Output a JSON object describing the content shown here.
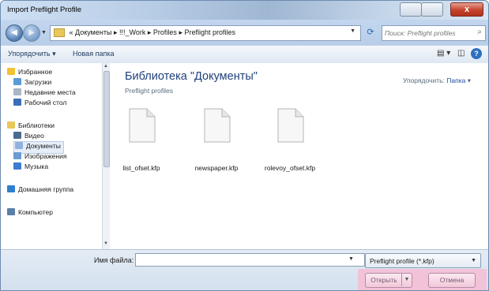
{
  "window": {
    "title": "Import Preflight Profile",
    "close_glyph": "x"
  },
  "address": {
    "prefix": "«",
    "crumbs": [
      "Документы",
      "!!!_Work",
      "Profiles",
      "Preflight profiles"
    ],
    "separator": "▸",
    "search_placeholder": "Поиск: Preflight profiles"
  },
  "toolbar": {
    "organize": "Упорядочить",
    "new_folder": "Новая папка"
  },
  "sidebar": {
    "items": [
      {
        "label": "Избранное",
        "icon": "star-icon",
        "color": "#f1c232"
      },
      {
        "label": "Загрузки",
        "icon": "downloads-icon",
        "color": "#5b9bd5"
      },
      {
        "label": "Недавние места",
        "icon": "recent-places-icon",
        "color": "#a9b7c6"
      },
      {
        "label": "Рабочий стол",
        "icon": "desktop-icon",
        "color": "#3a6fb7"
      },
      {
        "label": "Библиотеки",
        "icon": "libraries-icon",
        "color": "#e9c85a"
      },
      {
        "label": "Видео",
        "icon": "video-icon",
        "color": "#4a6a8f"
      },
      {
        "label": "Документы",
        "icon": "documents-icon",
        "color": "#8fb3dc"
      },
      {
        "label": "Изображения",
        "icon": "pictures-icon",
        "color": "#6b9bd2"
      },
      {
        "label": "Музыка",
        "icon": "music-icon",
        "color": "#3e7bd1"
      },
      {
        "label": "Домашняя группа",
        "icon": "homegroup-icon",
        "color": "#2f7fcf"
      },
      {
        "label": "Компьютер",
        "icon": "computer-icon",
        "color": "#5a7fa8"
      }
    ]
  },
  "library": {
    "title": "Библиотека \"Документы\"",
    "subtitle": "Preflight profiles",
    "arrange_label": "Упорядочить:",
    "arrange_value": "Папка"
  },
  "files": [
    {
      "name": "list_ofset.kfp"
    },
    {
      "name": "newspaper.kfp"
    },
    {
      "name": "rolevoy_ofset.kfp"
    }
  ],
  "footer": {
    "filename_label": "Имя файла:",
    "filename_value": "",
    "filter": "Preflight profile (*.kfp)",
    "open": "Открыть",
    "cancel": "Отмена"
  }
}
